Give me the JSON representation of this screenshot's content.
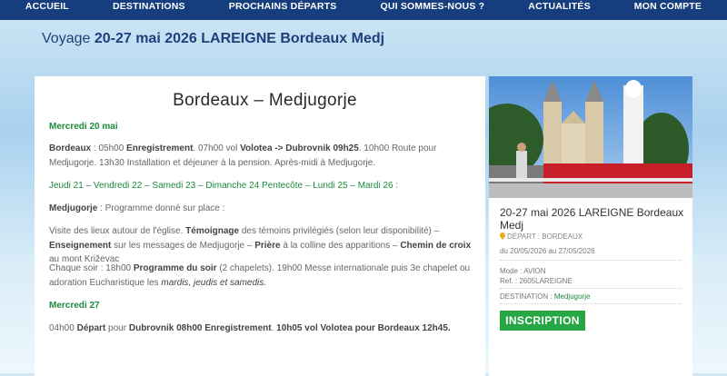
{
  "nav": {
    "items": [
      "ACCUEIL",
      "DESTINATIONS",
      "PROCHAINS DÉPARTS",
      "QUI SOMMES-NOUS ?",
      "ACTUALITÉS",
      "MON COMPTE"
    ]
  },
  "page": {
    "title_prefix": "Voyage ",
    "title_bold": "20-27 mai 2026 LAREIGNE Bordeaux Medj"
  },
  "article": {
    "heading": "Bordeaux – Medjugorje",
    "day1_label": "Mercredi 20 mai",
    "day1_text": {
      "a": "Bordeaux",
      "b": " : 05h00 ",
      "c": "Enregistrement",
      "d": ".  07h00 vol ",
      "e": "Volotea -> Dubrovnik 09h25",
      "f": ". 10h00 Route pour Medjugorje. 13h30 Installation et déjeuner à la pension. Après-midi  à Medjugorje."
    },
    "days_label": "Jeudi 21 – Vendredi 22 – Samedi 23 – Dimanche 24 Pentecôte – Lundi 25 – Mardi 26",
    "days_colon": " :",
    "program_line": {
      "a": "Medjugorje",
      "b": " : Programme donné sur place :"
    },
    "visits": {
      "a": "Visite des lieux autour de l'église. ",
      "b": "Témoignage",
      "c": " des témoins privilégiés (selon leur disponibilité) – ",
      "d": "Enseignement",
      "e": " sur les messages de Medjugorje – ",
      "f": "Prière",
      "g": " à la colline des apparitions – ",
      "h": "Chemin de croix",
      "i": " au mont Križevac"
    },
    "evening": {
      "a": "Chaque soir : 18h00 ",
      "b": "Programme du soir",
      "c": " (2 chapelets). 19h00 Messe internationale puis 3e chapelet ou adoration Eucharistique les ",
      "d": "mardis, jeudis et samedis."
    },
    "day_last_label": "Mercredi 27",
    "day_last_text": {
      "a": "04h00 ",
      "b": "Départ",
      "c": " pour ",
      "d": "Dubrovnik 08h00 Enregistrement",
      "e": ". ",
      "f": "10h05 vol Volotea pour Bordeaux 12h45."
    }
  },
  "sidebar": {
    "title": "20-27 mai 2026 LAREIGNE Bordeaux Medj",
    "departure": "DÉPART : BORDEAUX",
    "dates": "du 20/05/2026 au 27/05/2026",
    "mode": "Mode : AVION",
    "ref": "Ref. : 2605LAREIGNE",
    "destination_label": "DESTINATION : ",
    "destination_value": "Medjugorje",
    "button": "INSCRIPTION"
  },
  "colors": {
    "nav_bg": "#163d7d",
    "accent_green": "#1c8a3c",
    "button_green": "#27a744",
    "title_blue": "#1d3f7a"
  }
}
